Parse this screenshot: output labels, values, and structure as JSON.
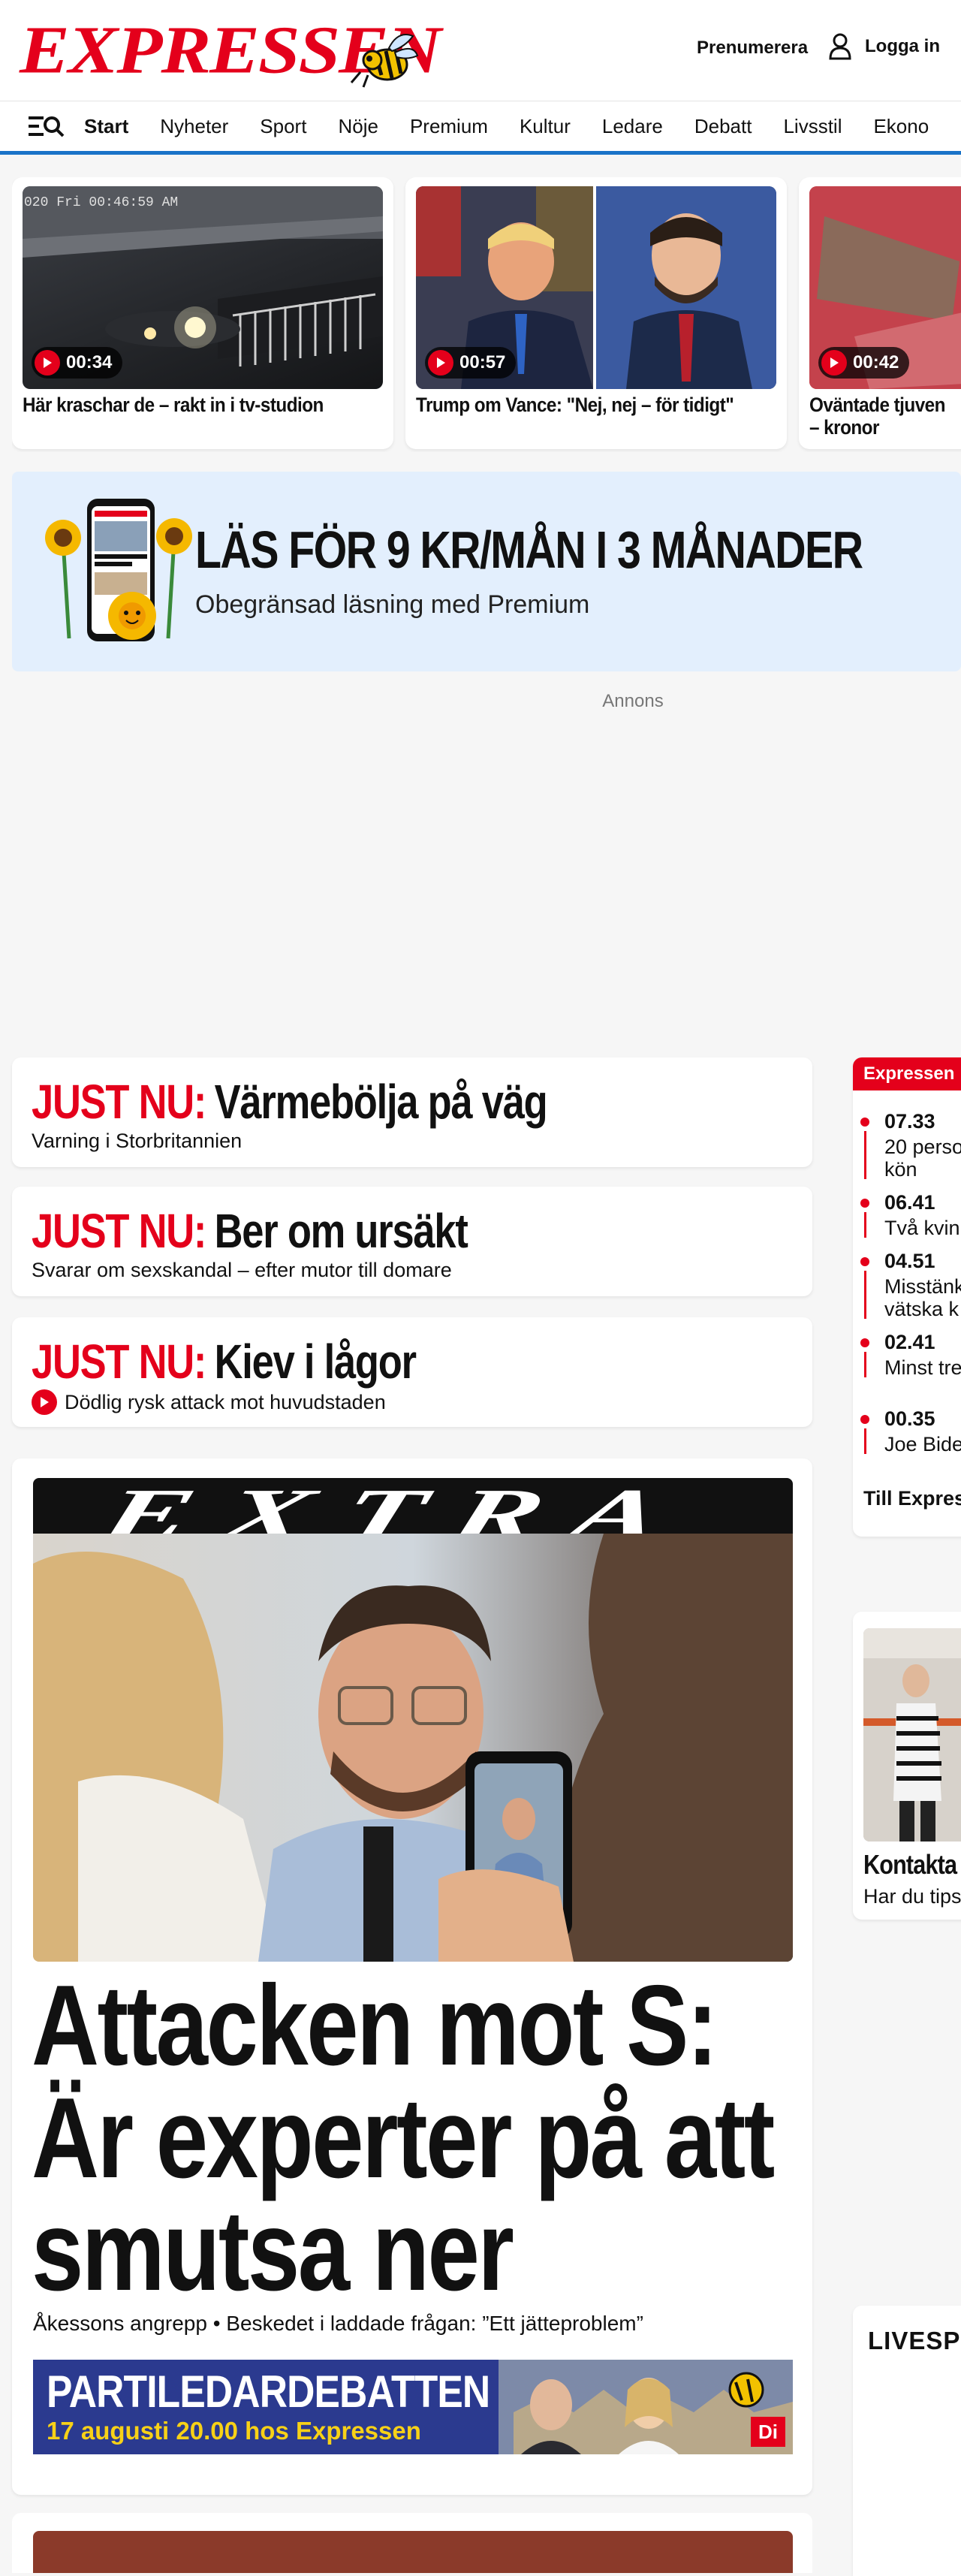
{
  "header": {
    "logo": "EXPRESSEN",
    "subscribe_label": "Prenumerera",
    "login_label": "Logga in"
  },
  "nav": {
    "items": [
      "Start",
      "Nyheter",
      "Sport",
      "Nöje",
      "Premium",
      "Kultur",
      "Ledare",
      "Debatt",
      "Livsstil",
      "Ekono"
    ],
    "active_index": 0
  },
  "videos": [
    {
      "duration": "00:34",
      "title": "Här kraschar de – rakt in i tv-studion",
      "overlay": "020 Fri  00:46:59 AM"
    },
    {
      "duration": "00:57",
      "title": "Trump om Vance: \"Nej, nej – för tidigt\""
    },
    {
      "duration": "00:42",
      "title": "Oväntade tjuven – kronor"
    }
  ],
  "promo": {
    "title": "LÄS FÖR 9 KR/MÅN I 3 MÅNADER",
    "subtitle": "Obegränsad läsning med Premium"
  },
  "ad_label": "Annons",
  "justnu": {
    "prefix": "JUST NU:",
    "items": [
      {
        "headline": "Värmebölja på väg",
        "sub": "Varning i Storbritannien",
        "video": false
      },
      {
        "headline": "Ber om ursäkt",
        "sub": "Svarar om sexskandal – efter mutor till domare",
        "video": false
      },
      {
        "headline": "Kiev i lågor",
        "sub": "Dödlig rysk attack mot huvudstaden",
        "video": true
      }
    ]
  },
  "main_story": {
    "kicker": "EXTRA",
    "headline": "Attacken mot S: Är experter på att smutsa ner",
    "sub": "Åkessons angrepp • Beskedet i laddade frågan: ”Ett jätteproblem”",
    "banner_title": "PARTILEDARDEBATTEN",
    "banner_date": "17 augusti 20.00 hos Expressen",
    "banner_badge": "Di"
  },
  "side_feed": {
    "header": "Expressen",
    "items": [
      {
        "time": "07.33",
        "text_lines": [
          "20 perso",
          "kön"
        ]
      },
      {
        "time": "06.41",
        "text_lines": [
          "Två kvin"
        ]
      },
      {
        "time": "04.51",
        "text_lines": [
          "Misstänk",
          "vätska k"
        ]
      },
      {
        "time": "02.41",
        "text_lines": [
          "Minst tre"
        ]
      },
      {
        "time": "00.35",
        "text_lines": [
          "Joe Bide"
        ]
      }
    ],
    "link": "Till Express"
  },
  "side_card": {
    "title": "Kontakta",
    "sub": "Har du tips"
  },
  "side_live": {
    "title": "LIVESP"
  },
  "colors": {
    "brand_red": "#e4001b",
    "nav_underline": "#1a73c8",
    "promo_bg": "#e3effd",
    "banner_blue": "#2b3a8f",
    "banner_yellow": "#f7d117"
  }
}
